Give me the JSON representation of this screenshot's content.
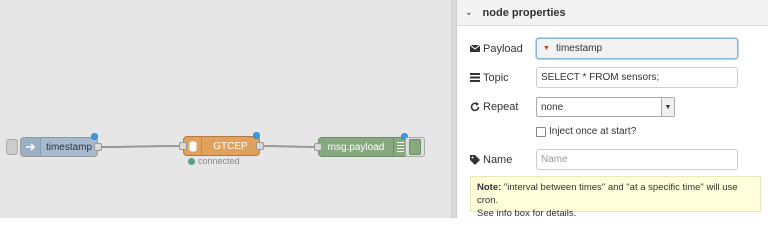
{
  "flow": {
    "nodes": {
      "inject": {
        "label": "timestamp"
      },
      "gtcep": {
        "label": "GTCEP",
        "status": "connected"
      },
      "debug": {
        "label": "msg.payload"
      }
    }
  },
  "panel": {
    "section_title": "node properties",
    "payload": {
      "label": "Payload",
      "value": "timestamp"
    },
    "topic": {
      "label": "Topic",
      "value": "SELECT * FROM sensors;"
    },
    "repeat": {
      "label": "Repeat",
      "value": "none"
    },
    "inject_once": {
      "label": "Inject once at start?"
    },
    "name": {
      "label": "Name",
      "placeholder": "Name"
    },
    "note": {
      "prefix": "Note:",
      "text": " \"interval between times\" and \"at a specific time\" will use cron.",
      "text2": "See info box for details."
    }
  },
  "colors": {
    "inject": "#a6bbcf",
    "gtcep": "#e1a15d",
    "debug": "#87a980",
    "status_connected": "#5aa17f",
    "changed_indicator": "#3a9ee4"
  }
}
